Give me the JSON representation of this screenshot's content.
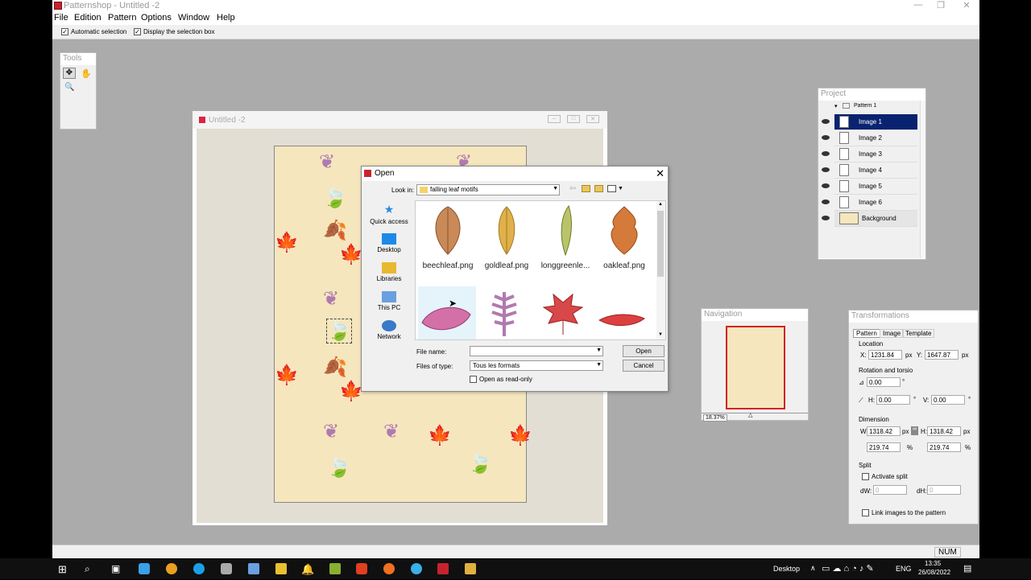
{
  "app": {
    "title": "Patternshop - Untitled -2",
    "menu": [
      "File",
      "Edition",
      "Pattern",
      "Options",
      "Window",
      "Help"
    ],
    "options": {
      "auto_selection": "Automatic selection",
      "display_box": "Display the selection box"
    }
  },
  "tools": {
    "title": "Tools"
  },
  "document": {
    "title": "Untitled -2"
  },
  "open_dialog": {
    "title": "Open",
    "look_in_label": "Look in:",
    "look_in_value": "falling leaf motifs",
    "places": [
      "Quick access",
      "Desktop",
      "Libraries",
      "This PC",
      "Network"
    ],
    "files": [
      "beechleaf.png",
      "goldleaf.png",
      "longgreenle...",
      "oakleaf.png"
    ],
    "file_name_label": "File name:",
    "file_name_value": "",
    "files_of_type_label": "Files of type:",
    "files_of_type_value": "Tous les formats",
    "read_only_label": "Open as read-only",
    "open_button": "Open",
    "cancel_button": "Cancel"
  },
  "project": {
    "title": "Project",
    "root": "Pattern 1",
    "layers": [
      "Image 1",
      "Image 2",
      "Image 3",
      "Image 4",
      "Image 5",
      "Image 6",
      "Background"
    ],
    "selected_index": 0
  },
  "navigation": {
    "title": "Navigation",
    "zoom": "18.37%"
  },
  "transformations": {
    "title": "Transformations",
    "tabs": [
      "Pattern",
      "Image",
      "Template"
    ],
    "location_label": "Location",
    "x_label": "X:",
    "x_value": "1231.84",
    "y_label": "Y:",
    "y_value": "1647.87",
    "px": "px",
    "rotation_label": "Rotation and torsio",
    "rotation_value": "0.00",
    "h_label": "H:",
    "h_value": "0.00",
    "v_label": "V:",
    "v_value": "0.00",
    "deg": "°",
    "dimension_label": "Dimension",
    "w_label": "W",
    "w_value": "1318.42",
    "dh_label": "H:",
    "dh_value": "1318.42",
    "pw_value": "219.74",
    "ph_value": "219.74",
    "pct": "%",
    "split_label": "Split",
    "activate_split": "Activate split",
    "dw_label": "dW:",
    "dw_value": "0",
    "dh2_label": "dH:",
    "dh2_value": "0",
    "link_images": "Link images to the pattern"
  },
  "status": {
    "num": "NUM"
  },
  "taskbar": {
    "desktop": "Desktop",
    "lang": "ENG",
    "time": "13:35",
    "date": "26/08/2022"
  }
}
